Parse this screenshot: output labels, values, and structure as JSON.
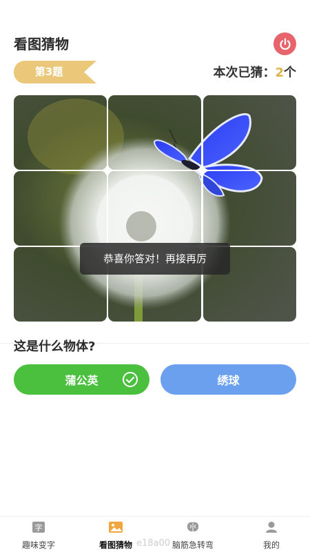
{
  "header": {
    "title": "看图猜物",
    "power_icon": "power-icon"
  },
  "level": {
    "label": "第3题"
  },
  "progress": {
    "prefix": "本次已猜：",
    "count": "2",
    "suffix": "个"
  },
  "puzzle": {
    "rows": 3,
    "cols": 3,
    "subject": "butterfly-on-dandelion"
  },
  "toast": {
    "text": "恭喜你答对！再接再厉"
  },
  "question": {
    "text": "这是什么物体?"
  },
  "answers": [
    {
      "label": "蒲公英",
      "state": "correct",
      "color": "#4bbf3e"
    },
    {
      "label": "绣球",
      "state": "normal",
      "color": "#6aa0ee"
    }
  ],
  "tabbar": {
    "items": [
      {
        "label": "趣味变字",
        "icon": "character-icon"
      },
      {
        "label": "看图猜物",
        "icon": "image-icon",
        "active": true
      },
      {
        "label": "脑筋急转弯",
        "icon": "brain-icon"
      },
      {
        "label": "我的",
        "icon": "user-icon"
      }
    ]
  },
  "watermark": {
    "text": "e18a00"
  },
  "colors": {
    "accent_gold": "#ebc77a",
    "power_red": "#e8646c",
    "correct_green": "#4bbf3e",
    "option_blue": "#6aa0ee"
  }
}
